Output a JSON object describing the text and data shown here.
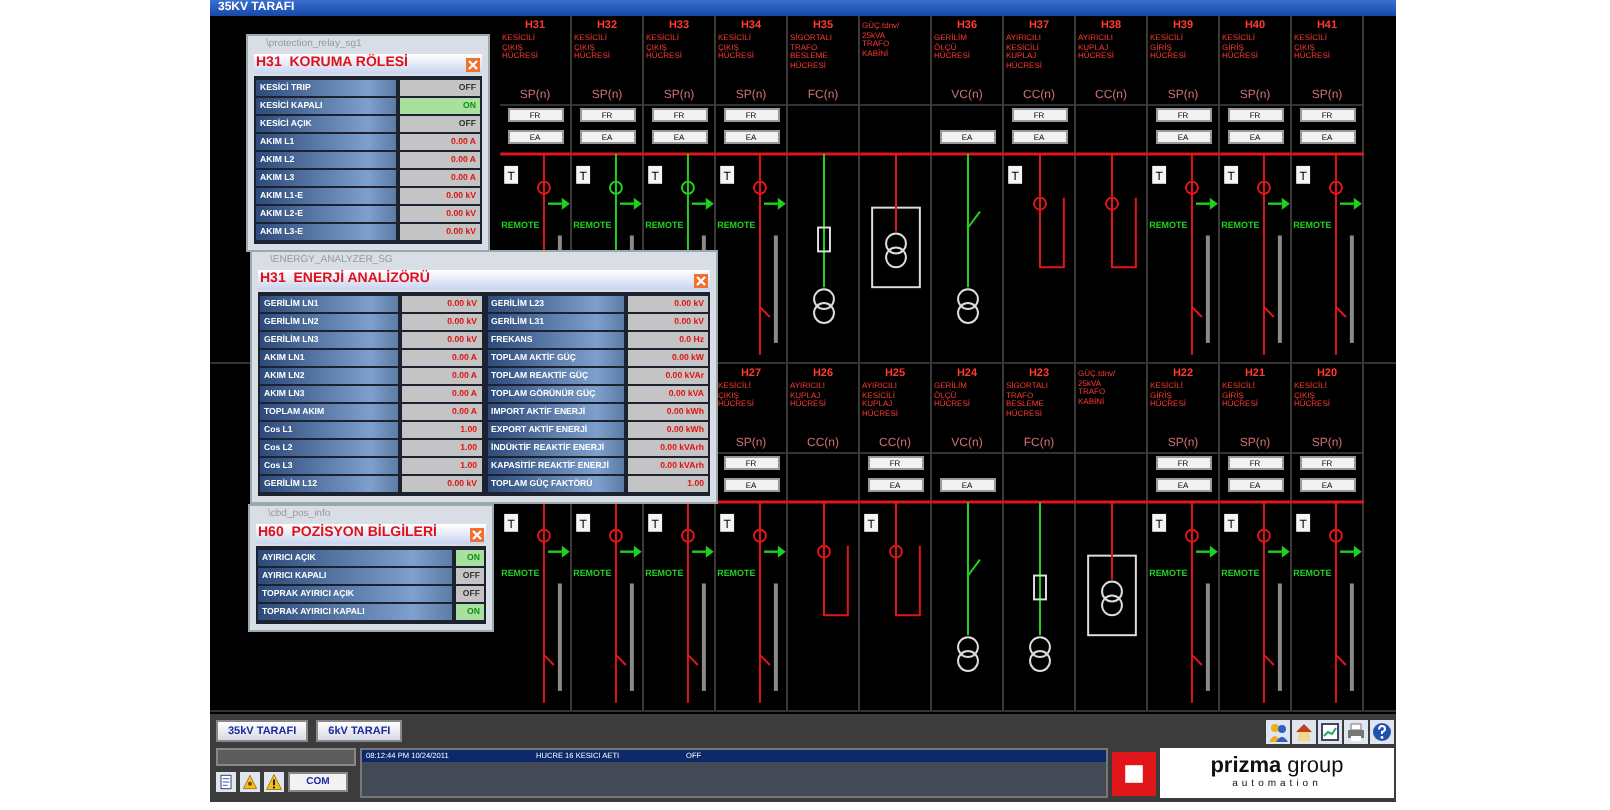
{
  "window": {
    "title": "35KV TARAFI"
  },
  "cell_rows": [
    {
      "cells": [
        {
          "kind": "breaker",
          "code": "H31",
          "lines": [
            "KESİCİLİ",
            "ÇIKIŞ",
            "HÜCRESİ"
          ],
          "type": "SP(n)",
          "fr": "FR",
          "ea": "EA",
          "tag": "T",
          "remote": "REMOTE",
          "energized": true
        },
        {
          "kind": "breaker",
          "code": "H32",
          "lines": [
            "KESİCİLİ",
            "ÇIKIŞ",
            "HÜCRESİ"
          ],
          "type": "SP(n)",
          "fr": "FR",
          "ea": "EA",
          "tag": "T",
          "remote": "REMOTE",
          "energized": false
        },
        {
          "kind": "breaker",
          "code": "H33",
          "lines": [
            "KESİCİLİ",
            "ÇIKIŞ",
            "HÜCRESİ"
          ],
          "type": "SP(n)",
          "fr": "FR",
          "ea": "EA",
          "tag": "T",
          "remote": "REMOTE",
          "energized": false
        },
        {
          "kind": "breaker",
          "code": "H34",
          "lines": [
            "KESİCİLİ",
            "ÇIKIŞ",
            "HÜCRESİ"
          ],
          "type": "SP(n)",
          "fr": "FR",
          "ea": "EA",
          "tag": "T",
          "remote": "REMOTE",
          "energized": true
        },
        {
          "kind": "fuse",
          "code": "H35",
          "lines": [
            "SİGORTALI",
            "TRAFO",
            "BESLEME",
            "HÜCRESİ"
          ],
          "type": "FC(n)",
          "energized": false
        },
        {
          "kind": "cabin",
          "lines": [
            "GÜÇ.tdnv/",
            "25kVA",
            "TRAFO",
            "KABİNİ"
          ],
          "energized": true
        },
        {
          "kind": "measure",
          "code": "H36",
          "lines": [
            "GERİLİM",
            "ÖLÇÜ",
            "HÜCRESİ"
          ],
          "type": "VC(n)",
          "ea": "EA",
          "energized": false
        },
        {
          "kind": "coupler",
          "code": "H37",
          "lines": [
            "AYIRICILI",
            "KESİCİLİ",
            "KUPLAJ",
            "HÜCRESİ"
          ],
          "type": "CC(n)",
          "fr": "FR",
          "ea": "EA",
          "tag": "T",
          "energized": true
        },
        {
          "kind": "coupler",
          "code": "H38",
          "lines": [
            "AYIRICILI",
            "KUPLAJ",
            "HÜCRESİ"
          ],
          "type": "CC(n)",
          "energized": true
        },
        {
          "kind": "breaker",
          "code": "H39",
          "lines": [
            "KESİCİLİ",
            "GİRİŞ",
            "HÜCRESİ"
          ],
          "type": "SP(n)",
          "fr": "FR",
          "ea": "EA",
          "tag": "T",
          "remote": "REMOTE",
          "energized": true
        },
        {
          "kind": "breaker",
          "code": "H40",
          "lines": [
            "KESİCİLİ",
            "GİRİŞ",
            "HÜCRESİ"
          ],
          "type": "SP(n)",
          "fr": "FR",
          "ea": "EA",
          "tag": "T",
          "remote": "REMOTE",
          "energized": true
        },
        {
          "kind": "breaker",
          "code": "H41",
          "lines": [
            "KESİCİLİ",
            "ÇIKIŞ",
            "HÜCRESİ"
          ],
          "type": "SP(n)",
          "fr": "FR",
          "ea": "EA",
          "tag": "T",
          "remote": "REMOTE",
          "energized": true
        }
      ]
    },
    {
      "cells": [
        {
          "kind": "breaker",
          "tag": "T",
          "remote": "REMOTE",
          "energized": true
        },
        {
          "kind": "breaker",
          "tag": "T",
          "remote": "REMOTE",
          "energized": true
        },
        {
          "kind": "breaker",
          "tag": "T",
          "remote": "REMOTE",
          "energized": true
        },
        {
          "kind": "breaker",
          "code": "H27",
          "lines": [
            "KESİCİLİ",
            "ÇIKIŞ",
            "HÜCRESİ"
          ],
          "type": "SP(n)",
          "fr": "FR",
          "ea": "EA",
          "tag": "T",
          "remote": "REMOTE",
          "energized": true
        },
        {
          "kind": "coupler",
          "code": "H26",
          "lines": [
            "AYIRICILI",
            "KUPLAJ",
            "HÜCRESİ"
          ],
          "type": "CC(n)",
          "energized": true
        },
        {
          "kind": "coupler",
          "code": "H25",
          "lines": [
            "AYIRICILI",
            "KESİCİLİ",
            "KUPLAJ",
            "HÜCRESİ"
          ],
          "type": "CC(n)",
          "fr": "FR",
          "ea": "EA",
          "tag": "T",
          "energized": true
        },
        {
          "kind": "measure",
          "code": "H24",
          "lines": [
            "GERİLİM",
            "ÖLÇÜ",
            "HÜCRESİ"
          ],
          "type": "VC(n)",
          "ea": "EA",
          "energized": false
        },
        {
          "kind": "fuse",
          "code": "H23",
          "lines": [
            "SİGORTALI",
            "TRAFO",
            "BESLEME",
            "HÜCRESİ"
          ],
          "type": "FC(n)",
          "energized": false
        },
        {
          "kind": "cabin",
          "lines": [
            "GÜÇ.tdnv/",
            "25kVA",
            "TRAFO",
            "KABİNİ"
          ],
          "energized": true
        },
        {
          "kind": "breaker",
          "code": "H22",
          "lines": [
            "KESİCİLİ",
            "GİRİŞ",
            "HÜCRESİ"
          ],
          "type": "SP(n)",
          "fr": "FR",
          "ea": "EA",
          "tag": "T",
          "remote": "REMOTE",
          "energized": true
        },
        {
          "kind": "breaker",
          "code": "H21",
          "lines": [
            "KESİCİLİ",
            "GİRİŞ",
            "HÜCRESİ"
          ],
          "type": "SP(n)",
          "fr": "FR",
          "ea": "EA",
          "tag": "T",
          "remote": "REMOTE",
          "energized": true
        },
        {
          "kind": "breaker",
          "code": "H20",
          "lines": [
            "KESİCİLİ",
            "ÇIKIŞ",
            "HÜCRESİ"
          ],
          "type": "SP(n)",
          "fr": "FR",
          "ea": "EA",
          "tag": "T",
          "remote": "REMOTE",
          "energized": true
        }
      ]
    }
  ],
  "panels": [
    {
      "caption": "\\protection_relay_sg1",
      "title": "H31  KORUMA RÖLESİ",
      "columns": [
        [
          {
            "label": "KESİCİ TRIP",
            "value": "OFF",
            "kind": "state",
            "on": false
          },
          {
            "label": "KESİCİ KAPALI",
            "value": "ON",
            "kind": "state",
            "on": true
          },
          {
            "label": "KESİCİ AÇIK",
            "value": "OFF",
            "kind": "state",
            "on": false
          },
          {
            "label": "AKIM L1",
            "value": "0.00 A",
            "kind": "reading"
          },
          {
            "label": "AKIM L2",
            "value": "0.00 A",
            "kind": "reading"
          },
          {
            "label": "AKIM L3",
            "value": "0.00 A",
            "kind": "reading"
          },
          {
            "label": "AKIM L1-E",
            "value": "0.00 kV",
            "kind": "reading"
          },
          {
            "label": "AKIM L2-E",
            "value": "0.00 kV",
            "kind": "reading"
          },
          {
            "label": "AKIM L3-E",
            "value": "0.00 kV",
            "kind": "reading"
          }
        ]
      ]
    },
    {
      "caption": "\\ENERGY_ANALYZER_SG",
      "title": "H31  ENERJİ ANALİZÖRÜ",
      "columns": [
        [
          {
            "label": "GERİLİM LN1",
            "value": "0.00 kV",
            "kind": "reading"
          },
          {
            "label": "GERİLİM LN2",
            "value": "0.00 kV",
            "kind": "reading"
          },
          {
            "label": "GERİLİM LN3",
            "value": "0.00 kV",
            "kind": "reading"
          },
          {
            "label": "AKIM LN1",
            "value": "0.00 A",
            "kind": "reading"
          },
          {
            "label": "AKIM LN2",
            "value": "0.00 A",
            "kind": "reading"
          },
          {
            "label": "AKIM LN3",
            "value": "0.00 A",
            "kind": "reading"
          },
          {
            "label": "TOPLAM AKIM",
            "value": "0.00 A",
            "kind": "reading"
          },
          {
            "label": "Cos L1",
            "value": "1.00",
            "kind": "reading"
          },
          {
            "label": "Cos L2",
            "value": "1.00",
            "kind": "reading"
          },
          {
            "label": "Cos L3",
            "value": "1.00",
            "kind": "reading"
          },
          {
            "label": "GERİLİM L12",
            "value": "0.00 kV",
            "kind": "reading"
          }
        ],
        [
          {
            "label": "GERİLİM L23",
            "value": "0.00 kV",
            "kind": "reading"
          },
          {
            "label": "GERİLİM L31",
            "value": "0.00 kV",
            "kind": "reading"
          },
          {
            "label": "FREKANS",
            "value": "0.0 Hz",
            "kind": "reading"
          },
          {
            "label": "TOPLAM AKTİF GÜÇ",
            "value": "0.00 kW",
            "kind": "reading"
          },
          {
            "label": "TOPLAM REAKTİF GÜÇ",
            "value": "0.00 kVAr",
            "kind": "reading"
          },
          {
            "label": "TOPLAM GÖRÜNÜR GÜÇ",
            "value": "0.00 kVA",
            "kind": "reading"
          },
          {
            "label": "IMPORT AKTİF ENERJİ",
            "value": "0.00 kWh",
            "kind": "reading"
          },
          {
            "label": "EXPORT AKTİF ENERJİ",
            "value": "0.00 kWh",
            "kind": "reading"
          },
          {
            "label": "İNDÜKTİF REAKTİF ENERJİ",
            "value": "0.00 kVArh",
            "kind": "reading"
          },
          {
            "label": "KAPASİTİF REAKTİF ENERJİ",
            "value": "0.00 kVArh",
            "kind": "reading"
          },
          {
            "label": "TOPLAM GÜÇ FAKTÖRÜ",
            "value": "1.00",
            "kind": "reading"
          }
        ]
      ]
    },
    {
      "caption": "\\cbd_pos_info",
      "title": "H60  POZİSYON BİLGİLERİ",
      "columns": [
        [
          {
            "label": "AYIRICI AÇIK",
            "value": "ON",
            "kind": "state",
            "on": true
          },
          {
            "label": "AYIRICI KAPALI",
            "value": "OFF",
            "kind": "state",
            "on": false
          },
          {
            "label": "TOPRAK AYIRICI AÇIK",
            "value": "OFF",
            "kind": "state",
            "on": false
          },
          {
            "label": "TOPRAK AYIRICI KAPALI",
            "value": "ON",
            "kind": "state",
            "on": true
          }
        ]
      ]
    }
  ],
  "bottom_bar": {
    "tabs": [
      {
        "label": "35kV TARAFI"
      },
      {
        "label": "6kV TARAFI"
      }
    ],
    "com_button": "COM",
    "events": [
      {
        "time": "08:12:44 PM 10/24/2011",
        "message": "HUCRE 16 KESICI AETI",
        "state": "OFF",
        "selected": true
      }
    ],
    "logo": {
      "name": "prizma",
      "suffix": "group",
      "tagline": "automation"
    }
  }
}
